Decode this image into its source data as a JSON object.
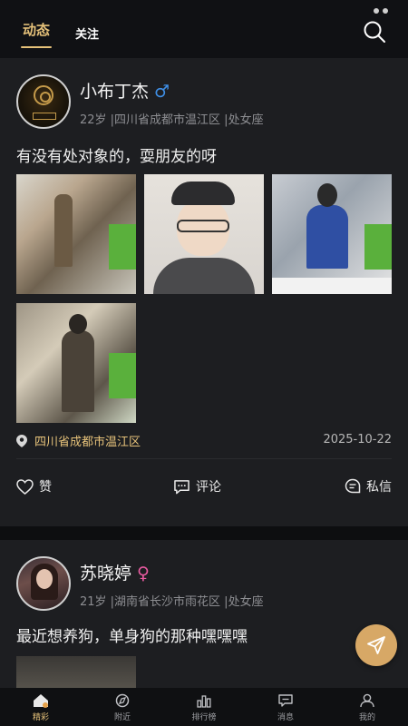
{
  "header": {
    "tabs": [
      {
        "label": "动态",
        "active": true
      },
      {
        "label": "关注",
        "active": false
      }
    ],
    "search_icon": "search-icon"
  },
  "posts": [
    {
      "name": "小布丁杰",
      "gender_symbol": "♂",
      "meta": "22岁 |四川省成都市温江区 |处女座",
      "text": "有没有处对象的，耍朋友的呀",
      "location": "四川省成都市温江区",
      "date": "2025-10-22",
      "actions": {
        "like": "赞",
        "comment": "评论",
        "message": "私信"
      },
      "avatar_logo_text": "小布丁杰"
    },
    {
      "name": "苏晓婷",
      "gender_symbol": "♀",
      "meta": "21岁 |湖南省长沙市雨花区 |处女座",
      "text": "最近想养狗，单身狗的那种嘿嘿嘿"
    }
  ],
  "bottom_nav": [
    {
      "label": "精彩",
      "icon": "home-icon",
      "active": true
    },
    {
      "label": "附近",
      "icon": "nearby-icon",
      "active": false
    },
    {
      "label": "排行榜",
      "icon": "ranking-icon",
      "active": false
    },
    {
      "label": "消息",
      "icon": "message-icon",
      "active": false
    },
    {
      "label": "我的",
      "icon": "profile-icon",
      "active": false
    }
  ],
  "colors": {
    "accent": "#e6c27a",
    "male": "#3f8fe6",
    "female": "#e85aa0",
    "fab": "#d7a866",
    "card": "#1d1e21",
    "background": "#0d0e10"
  }
}
